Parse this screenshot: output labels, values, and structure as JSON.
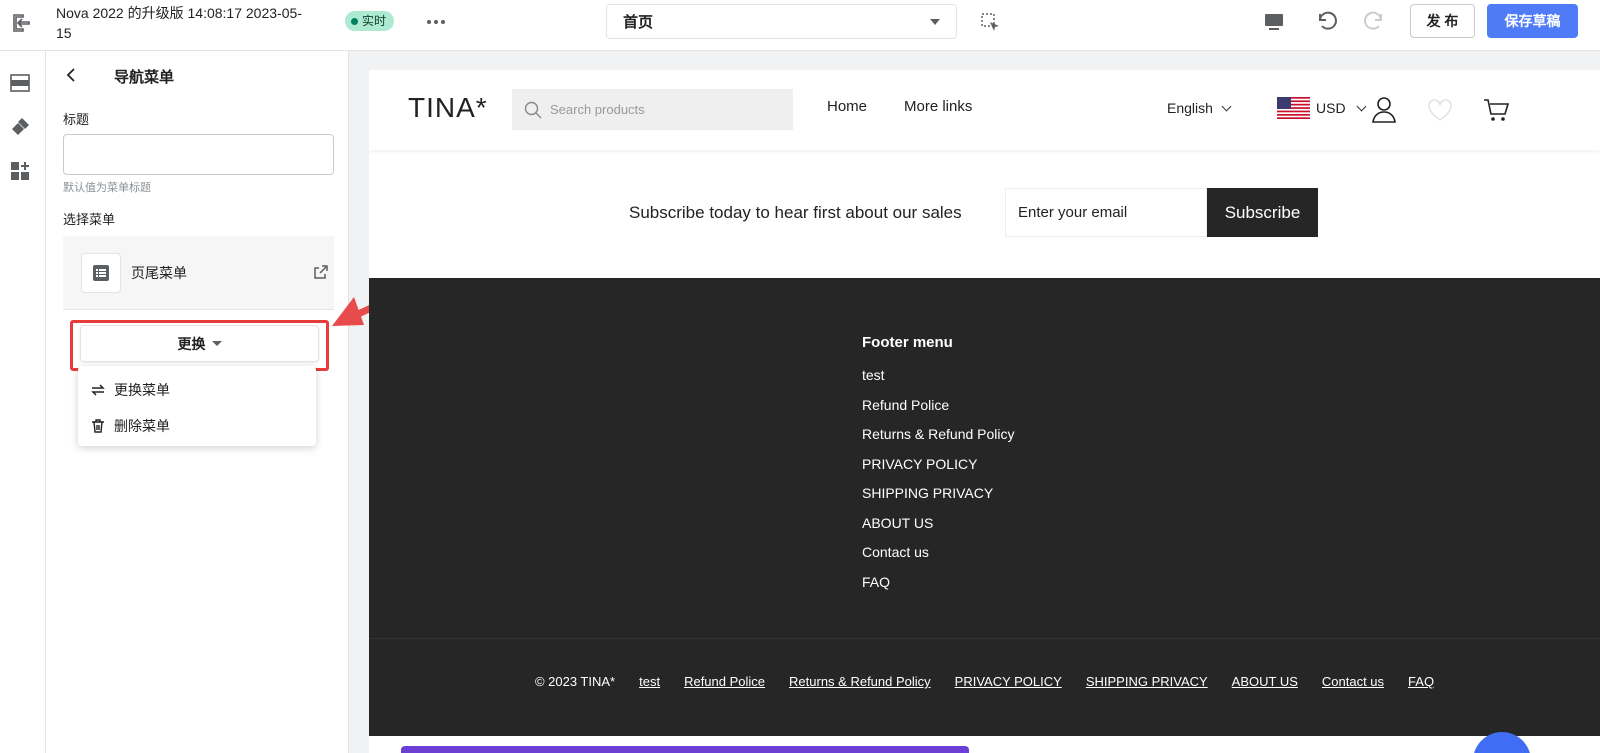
{
  "topbar": {
    "doc_title": "Nova 2022 的升级版 14:08:17 2023-05-15",
    "live_label": "实时",
    "page_select": "首页",
    "publish_label": "发 布",
    "save_label": "保存草稿"
  },
  "panel": {
    "title": "导航菜单",
    "title_field_label": "标题",
    "title_value": "",
    "title_hint": "默认值为菜单标题",
    "select_menu_label": "选择菜单",
    "selected_menu": "页尾菜单",
    "change_label": "更换",
    "dropdown": [
      {
        "label": "更换菜单",
        "icon": "swap-icon"
      },
      {
        "label": "删除菜单",
        "icon": "trash-icon"
      }
    ]
  },
  "preview": {
    "logo": "TINA*",
    "search_placeholder": "Search products",
    "nav": [
      "Home",
      "More links"
    ],
    "language": "English",
    "currency": "USD",
    "subscribe_text": "Subscribe today to hear first about our sales",
    "email_placeholder": "Enter your email",
    "subscribe_label": "Subscribe",
    "footer_heading": "Footer menu",
    "footer_links": [
      "test",
      "Refund Police",
      "Returns & Refund Policy",
      "PRIVACY POLICY",
      "SHIPPING PRIVACY",
      "ABOUT US",
      "Contact us",
      "FAQ"
    ],
    "copyright": "© 2023 TINA*",
    "bottom_links": [
      "test",
      "Refund Police",
      "Returns & Refund Policy",
      "PRIVACY POLICY",
      "SHIPPING PRIVACY",
      "ABOUT US",
      "Contact us",
      "FAQ"
    ]
  },
  "colors": {
    "accent": "#4f7bf7",
    "highlight": "#e63c3c",
    "footer_bg": "#262626",
    "live_badge": "#aee9d1"
  }
}
